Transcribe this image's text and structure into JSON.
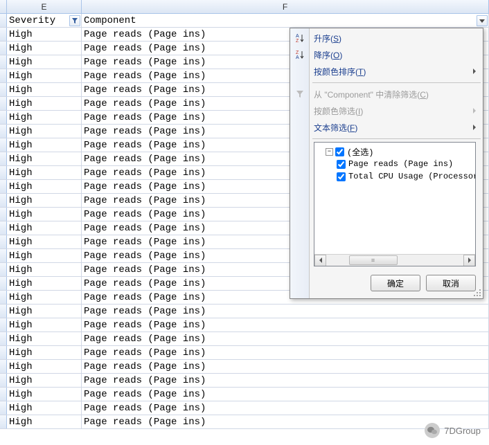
{
  "columns": {
    "e": {
      "letter": "E",
      "header": "Severity"
    },
    "f": {
      "letter": "F",
      "header": "Component"
    }
  },
  "rows": [
    {
      "e": "High",
      "f": "Page reads (Page ins)"
    },
    {
      "e": "High",
      "f": "Page reads (Page ins)"
    },
    {
      "e": "High",
      "f": "Page reads (Page ins)"
    },
    {
      "e": "High",
      "f": "Page reads (Page ins)"
    },
    {
      "e": "High",
      "f": "Page reads (Page ins)"
    },
    {
      "e": "High",
      "f": "Page reads (Page ins)"
    },
    {
      "e": "High",
      "f": "Page reads (Page ins)"
    },
    {
      "e": "High",
      "f": "Page reads (Page ins)"
    },
    {
      "e": "High",
      "f": "Page reads (Page ins)"
    },
    {
      "e": "High",
      "f": "Page reads (Page ins)"
    },
    {
      "e": "High",
      "f": "Page reads (Page ins)"
    },
    {
      "e": "High",
      "f": "Page reads (Page ins)"
    },
    {
      "e": "High",
      "f": "Page reads (Page ins)"
    },
    {
      "e": "High",
      "f": "Page reads (Page ins)"
    },
    {
      "e": "High",
      "f": "Page reads (Page ins)"
    },
    {
      "e": "High",
      "f": "Page reads (Page ins)"
    },
    {
      "e": "High",
      "f": "Page reads (Page ins)"
    },
    {
      "e": "High",
      "f": "Page reads (Page ins)"
    },
    {
      "e": "High",
      "f": "Page reads (Page ins)"
    },
    {
      "e": "High",
      "f": "Page reads (Page ins)"
    },
    {
      "e": "High",
      "f": "Page reads (Page ins)"
    },
    {
      "e": "High",
      "f": "Page reads (Page ins)"
    },
    {
      "e": "High",
      "f": "Page reads (Page ins)"
    },
    {
      "e": "High",
      "f": "Page reads (Page ins)"
    },
    {
      "e": "High",
      "f": "Page reads (Page ins)"
    },
    {
      "e": "High",
      "f": "Page reads (Page ins)"
    },
    {
      "e": "High",
      "f": "Page reads (Page ins)"
    },
    {
      "e": "High",
      "f": "Page reads (Page ins)"
    },
    {
      "e": "High",
      "f": "Page reads (Page ins)"
    }
  ],
  "menu": {
    "sort_asc": "升序(",
    "sort_asc_key": "S",
    "sort_desc": "降序(",
    "sort_desc_key": "O",
    "sort_by_color": "按颜色排序(",
    "sort_by_color_key": "T",
    "clear_filter_pre": "从 \"",
    "clear_filter_field": "Component",
    "clear_filter_post": "\" 中清除筛选(",
    "clear_filter_key": "C",
    "filter_by_color": "按颜色筛选(",
    "filter_by_color_key": "I",
    "text_filter": "文本筛选(",
    "text_filter_key": "F",
    "close_paren": ")",
    "select_all": "(全选)",
    "items": [
      "Page reads (Page ins)",
      "Total CPU Usage (Processor"
    ],
    "ok": "确定",
    "cancel": "取消"
  },
  "watermark": "7DGroup"
}
